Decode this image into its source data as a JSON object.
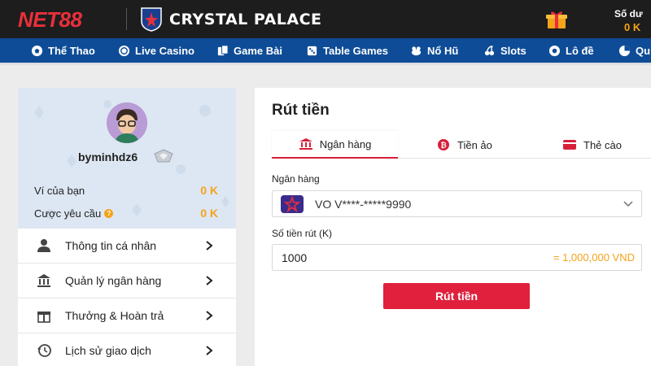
{
  "header": {
    "logo_text": "NET88",
    "club_name": "CRYSTAL PALACE",
    "balance_label": "Số dư",
    "balance_value": "0 K"
  },
  "nav": {
    "items": [
      {
        "label": "Thể Thao",
        "icon": "soccer-ball-icon"
      },
      {
        "label": "Live Casino",
        "icon": "casino-chip-icon"
      },
      {
        "label": "Game Bài",
        "icon": "cards-icon"
      },
      {
        "label": "Table Games",
        "icon": "dice-icon"
      },
      {
        "label": "Nổ Hũ",
        "icon": "jackpot-icon"
      },
      {
        "label": "Slots",
        "icon": "cherry-icon"
      },
      {
        "label": "Lô đề",
        "icon": "lottery-ball-icon"
      },
      {
        "label": "Qu",
        "icon": "pie-icon"
      }
    ]
  },
  "profile": {
    "username": "byminhdz6",
    "wallet_label": "Ví của bạn",
    "wallet_value": "0 K",
    "bet_label": "Cược yêu cầu",
    "bet_info": "?",
    "bet_value": "0 K"
  },
  "menu": {
    "items": [
      {
        "label": "Thông tin cá nhân",
        "icon": "user-icon"
      },
      {
        "label": "Quản lý ngân hàng",
        "icon": "bank-icon"
      },
      {
        "label": "Thưởng & Hoàn trả",
        "icon": "gift-icon"
      },
      {
        "label": "Lịch sử giao dịch",
        "icon": "history-icon"
      }
    ]
  },
  "withdraw": {
    "title": "Rút tiền",
    "tabs": [
      {
        "label": "Ngân hàng",
        "icon": "bank-icon",
        "active": true
      },
      {
        "label": "Tiền ảo",
        "icon": "bitcoin-icon",
        "active": false
      },
      {
        "label": "Thẻ cào",
        "icon": "card-icon",
        "active": false
      }
    ],
    "bank_label": "Ngân hàng",
    "bank_value": "VO V****-*****9990",
    "amount_label": "Số tiền rút (K)",
    "amount_value": "1000",
    "amount_converted": "= 1,000,000 VND",
    "submit_label": "Rút tiền"
  },
  "colors": {
    "brand_red": "#e0203c",
    "nav_blue": "#0f4c97",
    "accent_orange": "#f5a31a"
  }
}
